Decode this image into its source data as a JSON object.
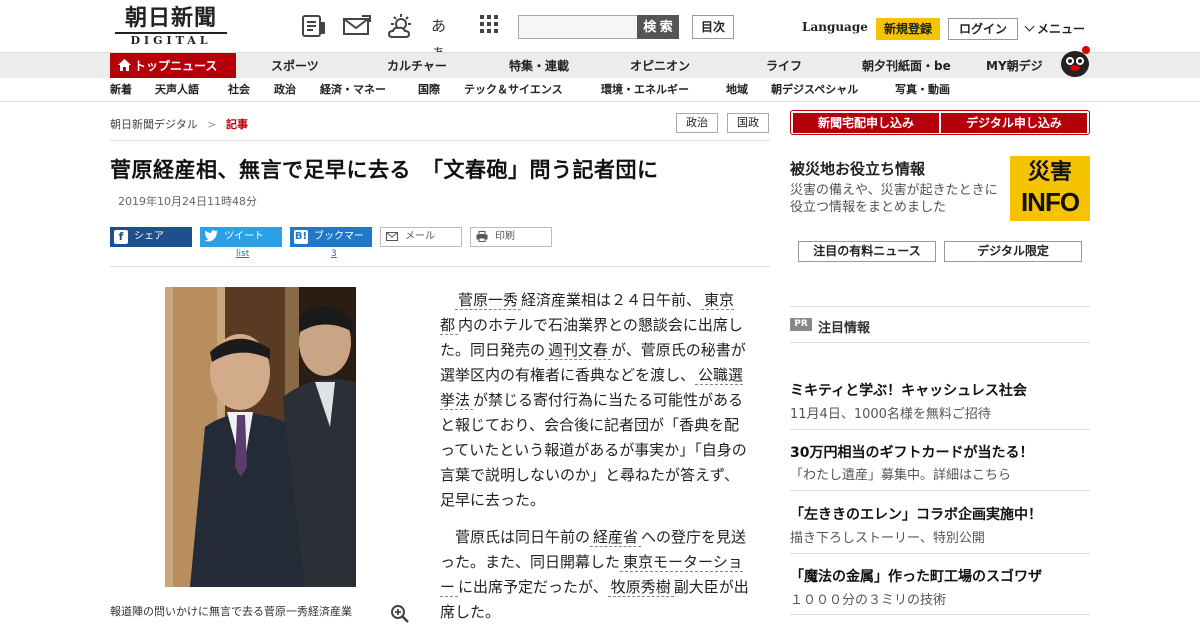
{
  "header": {
    "logo_ja": "朝日新聞",
    "logo_en": "DIGITAL",
    "icons": [
      "newspaper-icon",
      "mail-icon",
      "weather-icon",
      "font-size-icon",
      "grid-menu-icon"
    ],
    "font_size_label": "あぁ",
    "search_button": "検 索",
    "index_button": "目次",
    "language": "Language",
    "register": "新規登録",
    "login": "ログイン",
    "menu": "メニュー"
  },
  "nav_primary": [
    "トップニュース",
    "スポーツ",
    "カルチャー",
    "特集・連載",
    "オピニオン",
    "ライフ",
    "朝夕刊紙面・be",
    "MY朝デジ"
  ],
  "nav_secondary": [
    "新着",
    "天声人語",
    "社会",
    "政治",
    "経済・マネー",
    "国際",
    "テック＆サイエンス",
    "環境・エネルギー",
    "地域",
    "朝デジスペシャル",
    "写真・動画"
  ],
  "breadcrumb": {
    "home": "朝日新聞デジタル",
    "sep": ">",
    "current": "記事"
  },
  "tags": [
    "政治",
    "国政"
  ],
  "article": {
    "headline": "菅原経産相、無言で足早に去る　「文春砲」問う記者団に",
    "date": "2019年10月24日11時48分",
    "share": {
      "facebook": "シェア",
      "twitter": "ツイート",
      "twitter_sub": "list",
      "hatena": "ブックマーク",
      "hatena_count": "3",
      "mail": "メール",
      "print": "印刷"
    },
    "caption": "報道陣の問いかけに無言で去る菅原一秀経済産業",
    "p1": [
      {
        "t": "菅原一秀",
        "link": true
      },
      {
        "t": "経済産業相は２４日午前、",
        "link": false
      },
      {
        "t": "東京都",
        "link": true
      },
      {
        "t": "内のホテルで石油業界との懇談会に出席した。同日発売の",
        "link": false
      },
      {
        "t": "週刊文春",
        "link": true
      },
      {
        "t": "が、菅原氏の秘書が選挙区内の有権者に香典などを渡し、",
        "link": false
      },
      {
        "t": "公職選挙法",
        "link": true
      },
      {
        "t": "が禁じる寄付行為に当たる可能性があると報じており、会合後に記者団が「香典を配っていたという報道があるが事実か」「自身の言葉で説明しないのか」と尋ねたが答えず、足早に去った。",
        "link": false
      }
    ],
    "p2": [
      {
        "t": "菅原氏は同日午前の",
        "link": false
      },
      {
        "t": "経産省",
        "link": true
      },
      {
        "t": "への登庁を見送った。また、同日開幕した",
        "link": false
      },
      {
        "t": "東京モーターショー",
        "link": true
      },
      {
        "t": "に出席予定だったが、",
        "link": false
      },
      {
        "t": "牧原秀樹",
        "link": true
      },
      {
        "t": "副大臣が出席した。",
        "link": false
      }
    ]
  },
  "sidebar": {
    "apply_home": "新聞宅配申し込み",
    "apply_digital": "デジタル申し込み",
    "disaster_title": "被災地お役立ち情報",
    "disaster_desc": "災害の備えや、災害が起きたときに役立つ情報をまとめました",
    "info_badge_top": "災害",
    "info_badge_bottom": "INFO",
    "paid_news": "注目の有料ニュース",
    "digital_only": "デジタル限定",
    "pr_label": "PR",
    "pr_title": "注目情報",
    "ads": [
      {
        "title": "ミキティと学ぶ！キャッシュレス社会",
        "sub": "11月4日、1000名様を無料ご招待"
      },
      {
        "title": "30万円相当のギフトカードが当たる！",
        "sub": "「わたし遺産」募集中。詳細はこちら"
      },
      {
        "title": "「左ききのエレン」コラボ企画実施中！",
        "sub": "描き下ろしストーリー、特別公開"
      },
      {
        "title": "「魔法の金属」作った町工場のスゴワザ",
        "sub": "１０００分の３ミリの技術"
      }
    ]
  },
  "colors": {
    "brand_red": "#b5000c",
    "yellow": "#f5c300",
    "twitter": "#2aa0e6",
    "facebook": "#1e4f8e",
    "hatena": "#1f78c8"
  }
}
